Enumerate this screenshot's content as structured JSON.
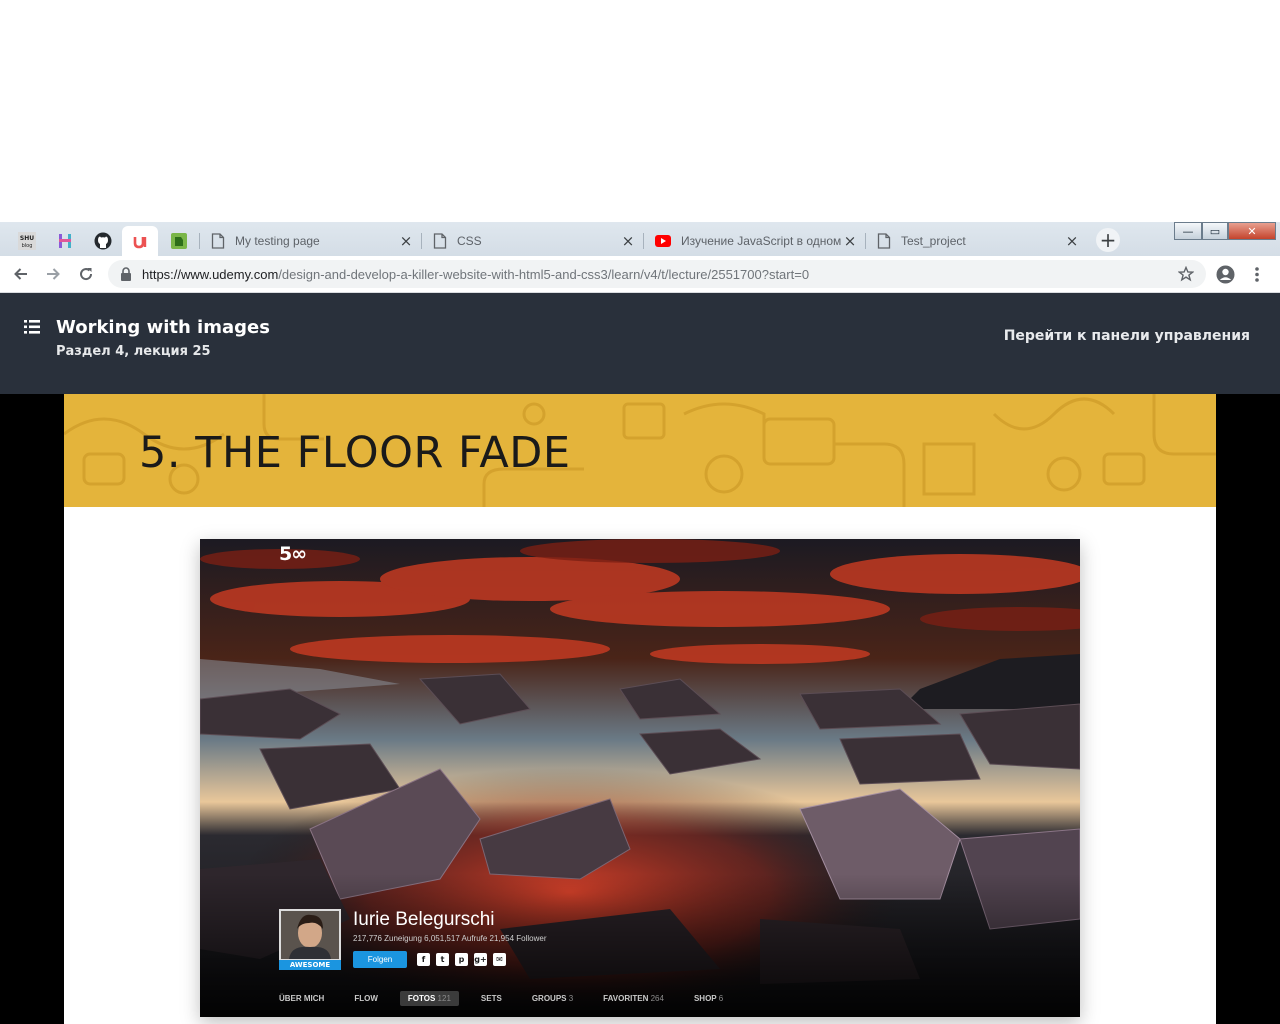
{
  "browser": {
    "pinned_tabs": [
      {
        "name": "shublog",
        "label": "SHU blog"
      },
      {
        "name": "hexlet",
        "label": "H"
      },
      {
        "name": "github",
        "label": ""
      },
      {
        "name": "udemy",
        "label": "u"
      },
      {
        "name": "evernote",
        "label": ""
      }
    ],
    "tabs": [
      {
        "title": "My testing page",
        "icon": "page-icon"
      },
      {
        "title": "CSS",
        "icon": "page-icon"
      },
      {
        "title": "Изучение JavaScript в одном",
        "icon": "youtube-icon"
      },
      {
        "title": "Test_project",
        "icon": "page-icon"
      }
    ],
    "close_glyph": "×",
    "new_tab_glyph": "+",
    "window_controls": {
      "minimize": "—",
      "restore": "▭",
      "close": "✕"
    },
    "url_host": "https://www.udemy.com",
    "url_path": "/design-and-develop-a-killer-website-with-html5-and-css3/learn/v4/t/lecture/2551700?start=0"
  },
  "course": {
    "lecture_title": "Working with images",
    "lecture_sub": "Раздел 4, лекция 25",
    "dashboard_link": "Перейти к панели управления"
  },
  "slide": {
    "heading": "5. THE FLOOR FADE",
    "accent": "#e4b43b"
  },
  "profile": {
    "brand": "5∞",
    "badge": "AWESOME",
    "name": "Iurie Belegurschi",
    "stats": "217,776 Zuneigung   6,051,517 Aufrufe   21,954 Follower",
    "follow": "Folgen",
    "nav": [
      {
        "label": "ÜBER MICH",
        "count": ""
      },
      {
        "label": "FLOW",
        "count": ""
      },
      {
        "label": "FOTOS",
        "count": "121"
      },
      {
        "label": "SETS",
        "count": ""
      },
      {
        "label": "GROUPS",
        "count": "3"
      },
      {
        "label": "FAVORITEN",
        "count": "264"
      },
      {
        "label": "SHOP",
        "count": "6"
      }
    ]
  }
}
